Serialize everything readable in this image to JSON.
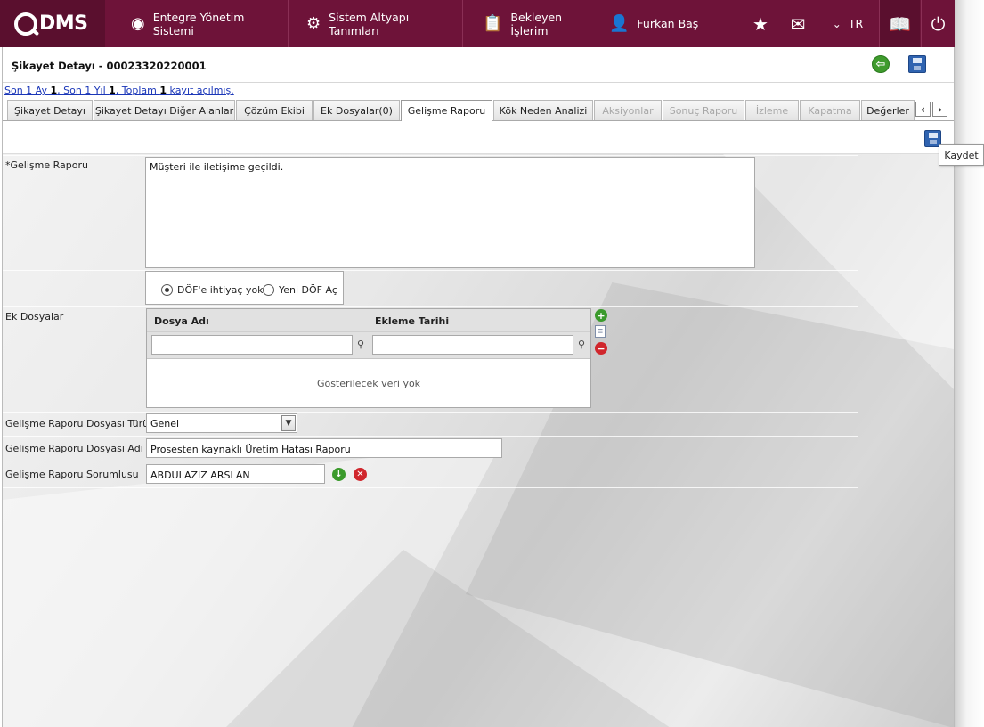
{
  "topbar": {
    "logo_text": "DMS",
    "nav": [
      {
        "label": "Entegre Yönetim Sistemi"
      },
      {
        "label": "Sistem Altyapı Tanımları"
      },
      {
        "label": "Bekleyen İşlerim"
      },
      {
        "label": "Furkan Baş"
      }
    ],
    "language": "TR"
  },
  "header": {
    "title": "Şikayet Detayı - 00023320220001",
    "recent_prefix": "Son 1 Ay ",
    "recent_month_count": "1",
    "recent_middle": ", Son 1 Yıl ",
    "recent_year_count": "1",
    "recent_total_label": ", Toplam ",
    "recent_total_count": "1",
    "recent_suffix": " kayıt açılmış."
  },
  "tabs": [
    {
      "label": "Şikayet Detayı",
      "state": "normal"
    },
    {
      "label": "Şikayet Detayı Diğer Alanlar",
      "state": "normal"
    },
    {
      "label": "Çözüm Ekibi",
      "state": "normal"
    },
    {
      "label": "Ek Dosyalar(0)",
      "state": "normal"
    },
    {
      "label": "Gelişme Raporu",
      "state": "active"
    },
    {
      "label": "Kök Neden Analizi",
      "state": "normal"
    },
    {
      "label": "Aksiyonlar",
      "state": "disabled"
    },
    {
      "label": "Sonuç Raporu",
      "state": "disabled"
    },
    {
      "label": "İzleme",
      "state": "disabled"
    },
    {
      "label": "Kapatma",
      "state": "disabled"
    },
    {
      "label": "Değerler",
      "state": "normal"
    }
  ],
  "tooltip": "Kaydet",
  "form": {
    "report_label": "*Gelişme Raporu",
    "report_text": "Müşteri ile iletişime geçildi.",
    "radio_options": [
      {
        "label": "DÖF'e ihtiyaç yok",
        "checked": true
      },
      {
        "label": "Yeni DÖF Aç",
        "checked": false
      }
    ],
    "attachments_label": "Ek Dosyalar",
    "attachments_columns": [
      "Dosya Adı",
      "Ekleme Tarihi"
    ],
    "attachments_empty": "Gösterilecek veri yok",
    "file_type_label": "Gelişme Raporu Dosyası Türü",
    "file_type_value": "Genel",
    "file_name_label": "Gelişme Raporu Dosyası Adı",
    "file_name_value": "Prosesten kaynaklı Üretim Hatası Raporu",
    "owner_label": "Gelişme Raporu Sorumlusu",
    "owner_value": "ABDULAZİZ ARSLAN"
  },
  "colors": {
    "brand": "#6e1339",
    "success": "#3b9a2c",
    "danger": "#d0262c",
    "save": "#2f63b0"
  }
}
